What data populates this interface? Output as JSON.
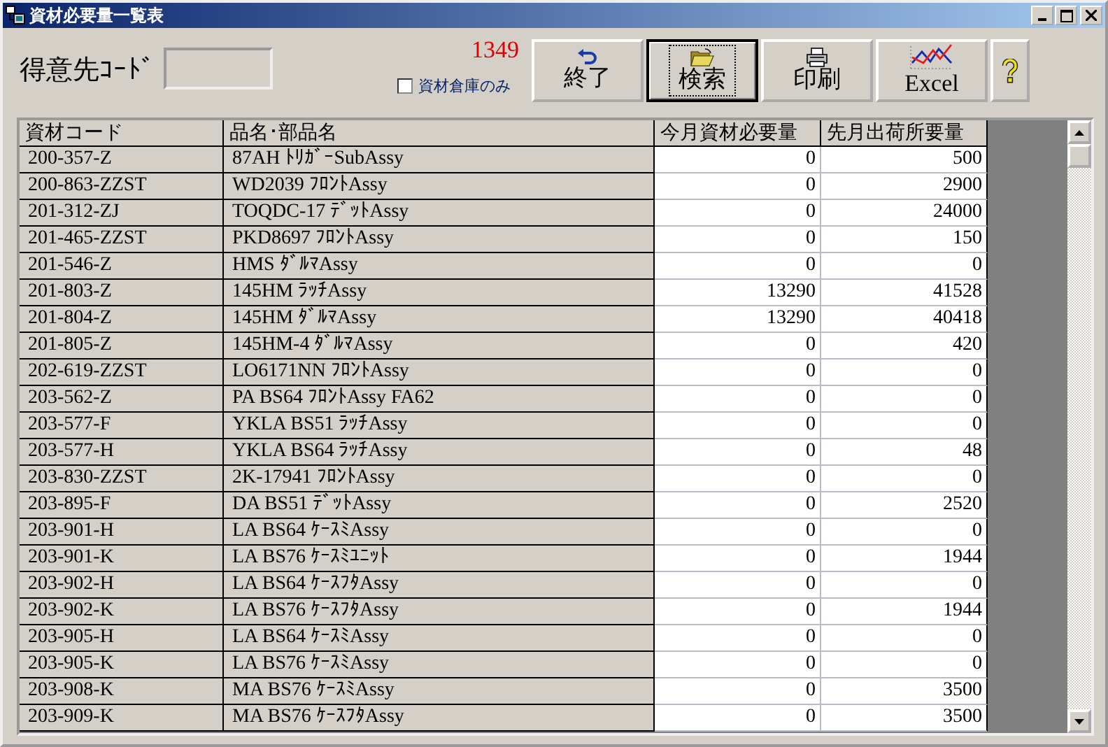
{
  "window": {
    "title": "資材必要量一覧表"
  },
  "customer_code": {
    "label": "得意先ｺｰﾄﾞ"
  },
  "count": "1349",
  "warehouse_only": {
    "label": "資材倉庫のみ",
    "checked": false
  },
  "buttons": [
    {
      "kind": "exit",
      "label": "終了",
      "focused": false
    },
    {
      "kind": "search",
      "label": "検索",
      "focused": true
    },
    {
      "kind": "print",
      "label": "印刷",
      "focused": false
    },
    {
      "kind": "excel",
      "label": "Excel",
      "focused": false
    },
    {
      "kind": "help",
      "focused": false
    }
  ],
  "table": {
    "columns": [
      "資材コード",
      "品名･部品名",
      "今月資材必要量",
      "先月出荷所要量"
    ],
    "rows": [
      [
        "200-357-Z",
        "87AH ﾄﾘｶﾞｰSubAssy",
        "0",
        "500"
      ],
      [
        "200-863-ZZST",
        "WD2039 ﾌﾛﾝﾄAssy",
        "0",
        "2900"
      ],
      [
        "201-312-ZJ",
        "TOQDC-17 ﾃﾞｯﾄAssy",
        "0",
        "24000"
      ],
      [
        "201-465-ZZST",
        "PKD8697 ﾌﾛﾝﾄAssy",
        "0",
        "150"
      ],
      [
        "201-546-Z",
        "HMS ﾀﾞﾙﾏAssy",
        "0",
        "0"
      ],
      [
        "201-803-Z",
        "145HM ﾗｯﾁAssy",
        "13290",
        "41528"
      ],
      [
        "201-804-Z",
        "145HM ﾀﾞﾙﾏAssy",
        "13290",
        "40418"
      ],
      [
        "201-805-Z",
        "145HM-4 ﾀﾞﾙﾏAssy",
        "0",
        "420"
      ],
      [
        "202-619-ZZST",
        "LO6171NN ﾌﾛﾝﾄAssy",
        "0",
        "0"
      ],
      [
        "203-562-Z",
        "PA BS64 ﾌﾛﾝﾄAssy FA62",
        "0",
        "0"
      ],
      [
        "203-577-F",
        "YKLA BS51 ﾗｯﾁAssy",
        "0",
        "0"
      ],
      [
        "203-577-H",
        "YKLA BS64 ﾗｯﾁAssy",
        "0",
        "48"
      ],
      [
        "203-830-ZZST",
        "2K-17941 ﾌﾛﾝﾄAssy",
        "0",
        "0"
      ],
      [
        "203-895-F",
        "DA BS51 ﾃﾞｯﾄAssy",
        "0",
        "2520"
      ],
      [
        "203-901-H",
        "LA BS64 ｹｰｽﾐAssy",
        "0",
        "0"
      ],
      [
        "203-901-K",
        "LA BS76 ｹｰｽﾐﾕﾆｯﾄ",
        "0",
        "1944"
      ],
      [
        "203-902-H",
        "LA BS64 ｹｰｽﾌﾀAssy",
        "0",
        "0"
      ],
      [
        "203-902-K",
        "LA BS76 ｹｰｽﾌﾀAssy",
        "0",
        "1944"
      ],
      [
        "203-905-H",
        "LA BS64 ｹｰｽﾐAssy",
        "0",
        "0"
      ],
      [
        "203-905-K",
        "LA BS76 ｹｰｽﾐAssy",
        "0",
        "0"
      ],
      [
        "203-908-K",
        "MA BS76 ｹｰｽﾐAssy",
        "0",
        "3500"
      ],
      [
        "203-909-K",
        "MA BS76 ｹｰｽﾌﾀAssy",
        "0",
        "3500"
      ]
    ]
  }
}
